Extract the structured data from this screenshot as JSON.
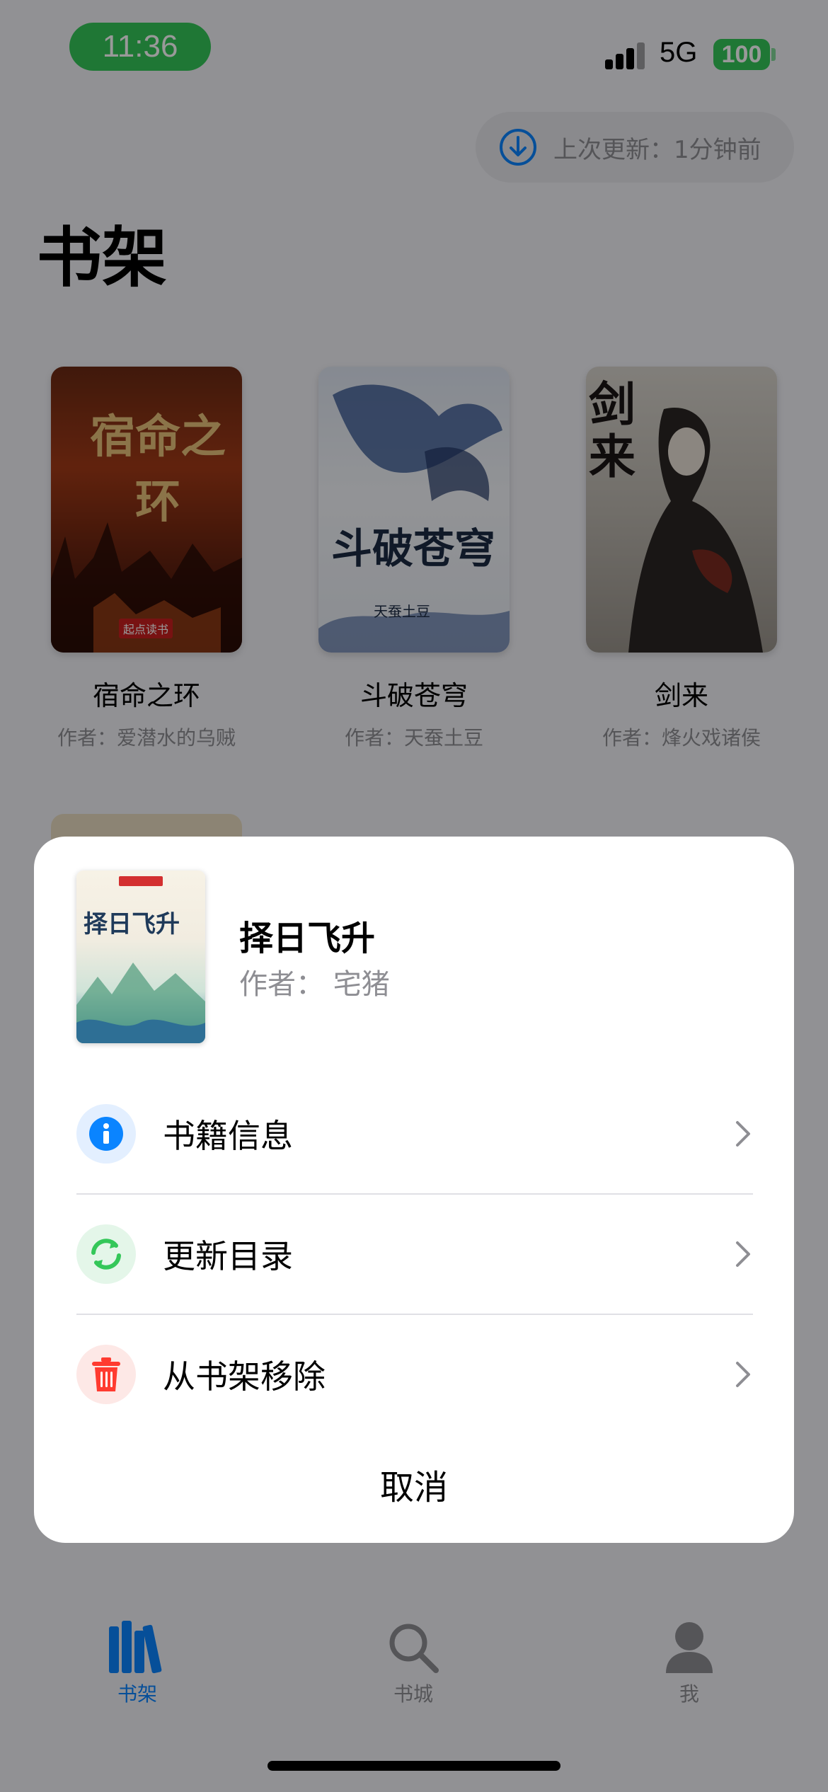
{
  "status_bar": {
    "time": "11:36",
    "network": "5G",
    "battery": "100"
  },
  "update": {
    "text": "上次更新：1分钟前"
  },
  "page": {
    "title": "书架"
  },
  "books": [
    {
      "title": "宿命之环",
      "author": "作者：爱潜水的乌贼",
      "cover_text": "宿命之环",
      "publisher": "起点读书"
    },
    {
      "title": "斗破苍穹",
      "author": "作者：天蚕土豆",
      "cover_text": "斗破苍穹",
      "cover_sub": "天蚕土豆"
    },
    {
      "title": "剑来",
      "author": "作者：烽火戏诸侯",
      "cover_text": "剑来"
    }
  ],
  "sheet": {
    "book_title": "择日飞升",
    "book_author": "作者：  宅猪",
    "cover_text": "择日飞升",
    "actions": [
      {
        "label": "书籍信息",
        "icon": "info-icon",
        "color": "#0a84ff"
      },
      {
        "label": "更新目录",
        "icon": "refresh-icon",
        "color": "#34c759"
      },
      {
        "label": "从书架移除",
        "icon": "trash-icon",
        "color": "#ff3b30"
      }
    ],
    "cancel": "取消"
  },
  "tabs": [
    {
      "label": "书架",
      "icon": "bookshelf-icon",
      "active": true
    },
    {
      "label": "书城",
      "icon": "search-icon",
      "active": false
    },
    {
      "label": "我",
      "icon": "person-icon",
      "active": false
    }
  ],
  "colors": {
    "accent": "#0a84ff",
    "green": "#34c759",
    "red": "#ff3b30",
    "inactive": "#8e8e93"
  }
}
